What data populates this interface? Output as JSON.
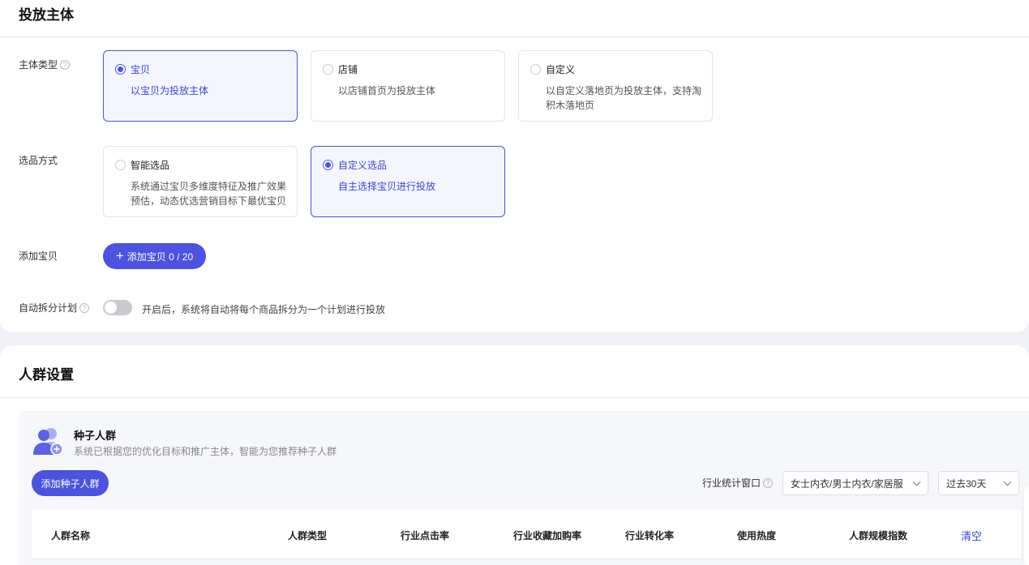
{
  "section1": {
    "title": "投放主体",
    "subject_type": {
      "label": "主体类型",
      "options": [
        {
          "title": "宝贝",
          "desc": "以宝贝为投放主体",
          "selected": true
        },
        {
          "title": "店铺",
          "desc": "以店铺首页为投放主体",
          "selected": false
        },
        {
          "title": "自定义",
          "desc": "以自定义落地页为投放主体，支持淘积木落地页",
          "selected": false
        }
      ]
    },
    "selection_mode": {
      "label": "选品方式",
      "options": [
        {
          "title": "智能选品",
          "desc": "系统通过宝贝多维度特征及推广效果预估，动态优选营销目标下最优宝贝",
          "selected": false
        },
        {
          "title": "自定义选品",
          "desc": "自主选择宝贝进行投放",
          "selected": true
        }
      ]
    },
    "add_item": {
      "label": "添加宝贝",
      "button": "添加宝贝 0 / 20"
    },
    "auto_split": {
      "label": "自动拆分计划",
      "enabled": false,
      "hint": "开启后，系统将自动将每个商品拆分为一个计划进行投放"
    }
  },
  "section2": {
    "title": "人群设置",
    "seed": {
      "title": "种子人群",
      "desc": "系统已根据您的优化目标和推广主体，智能为您推荐种子人群",
      "add_button": "添加种子人群"
    },
    "filters": {
      "window_label": "行业统计窗口",
      "category": "女士内衣/男士内衣/家居服",
      "period": "过去30天"
    },
    "table": {
      "columns": [
        "人群名称",
        "人群类型",
        "行业点击率",
        "行业收藏加购率",
        "行业转化率",
        "使用热度",
        "人群规模指数"
      ],
      "clear_label": "清空"
    }
  },
  "colors": {
    "accent": "#4b53e0",
    "selected_bg": "#f4f5fe"
  }
}
